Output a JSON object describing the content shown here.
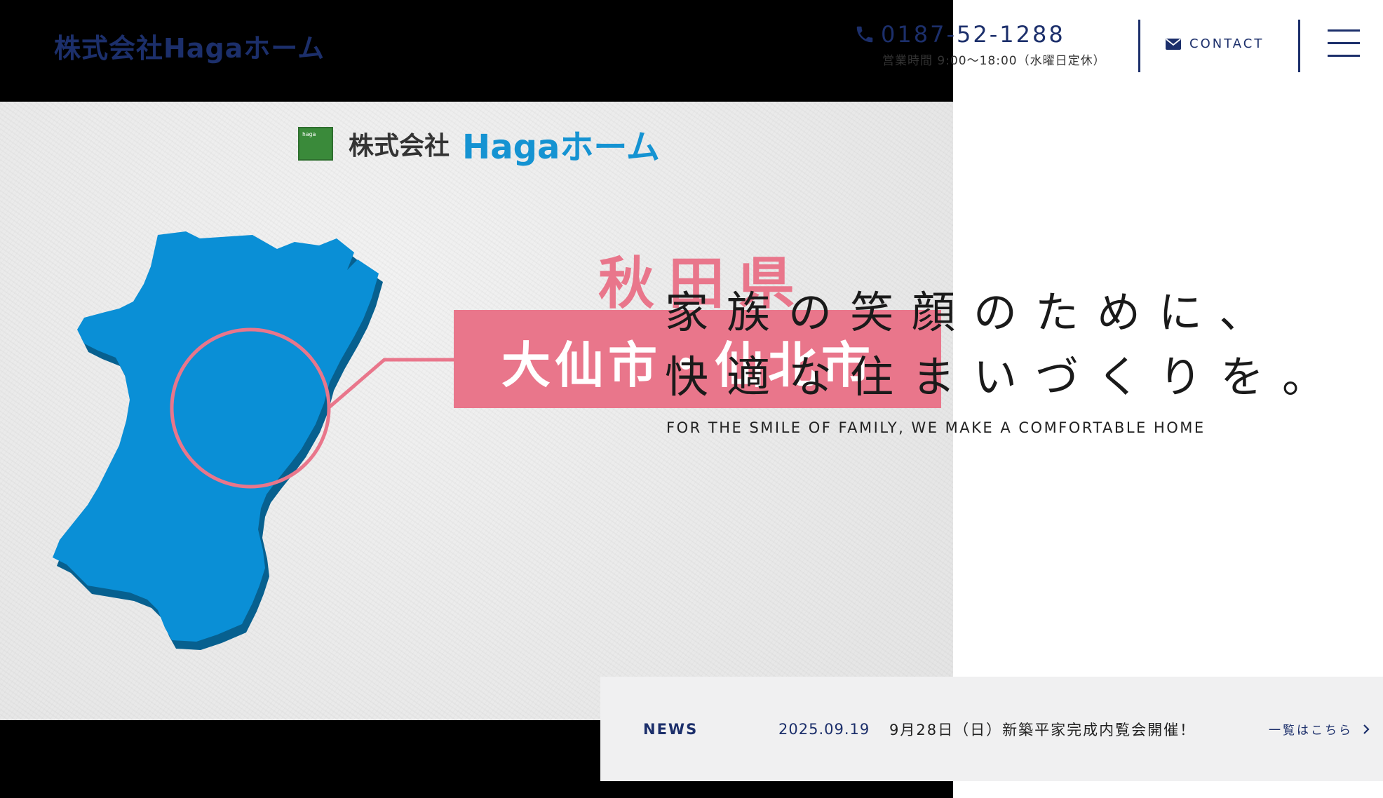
{
  "header": {
    "logo": "株式会社Hagaホーム",
    "phone": "0187-52-1288",
    "hours": "営業時間 9:00〜18:00（水曜日定休）",
    "contact_label": "CONTACT"
  },
  "hero_video": {
    "logo_company": "株式会社",
    "logo_name": "Hagaホーム",
    "logo_box_text": "haga",
    "prefecture": "秋田県",
    "cities": "大仙市・仙北市"
  },
  "catch": {
    "line1": "家族の笑顔のために、",
    "line2": "快適な住まいづくりを。",
    "english": "FOR THE SMILE OF FAMILY, WE MAKE A COMFORTABLE HOME"
  },
  "news": {
    "heading": "NEWS",
    "date": "2025.09.19",
    "title": "9月28日（日）新築平家完成内覧会開催！",
    "more_label": "一覧はこちら"
  },
  "colors": {
    "brand_navy": "#1c2f6b",
    "map_blue": "#0a8fd6",
    "accent_pink": "#e9768b"
  }
}
